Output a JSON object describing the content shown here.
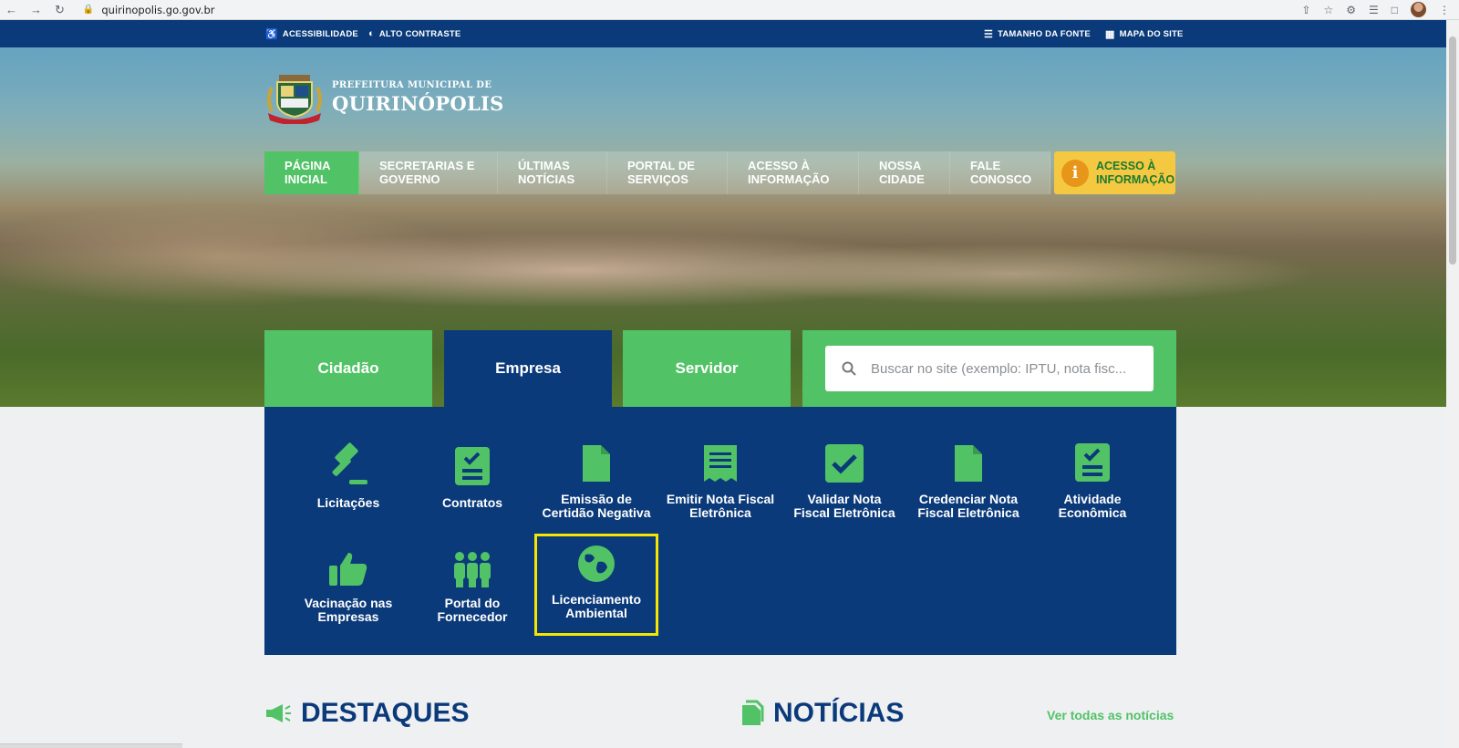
{
  "browser": {
    "url": "quirinopolis.go.gov.br"
  },
  "topbar": {
    "accessibility": "ACESSIBILIDADE",
    "contrast": "ALTO CONTRASTE",
    "font_size": "TAMANHO DA FONTE",
    "sitemap": "MAPA DO SITE"
  },
  "brand": {
    "line1": "PREFEITURA MUNICIPAL DE",
    "line2": "QUIRINÓPOLIS",
    "crest_text": "QUIRINÓPOLIS"
  },
  "menu": {
    "items": [
      {
        "line1": "Página",
        "line2": "Inicial"
      },
      {
        "line1": "Secretarias e",
        "line2": "Governo"
      },
      {
        "line1": "Últimas",
        "line2": "Notícias"
      },
      {
        "line1": "Portal de",
        "line2": "Serviços"
      },
      {
        "line1": "Acesso à",
        "line2": "Informação"
      },
      {
        "line1": "Nossa",
        "line2": "Cidade"
      },
      {
        "line1": "Fale",
        "line2": "Conosco"
      }
    ],
    "access_button": {
      "line1": "Acesso à",
      "line2": "Informação"
    }
  },
  "tabs": [
    "Cidadão",
    "Empresa",
    "Servidor"
  ],
  "search": {
    "placeholder": "Buscar no site (exemplo: IPTU, nota fisc..."
  },
  "services": [
    {
      "icon": "gavel-icon",
      "line1": "Licitações",
      "line2": ""
    },
    {
      "icon": "clipboard-check-icon",
      "line1": "Contratos",
      "line2": ""
    },
    {
      "icon": "file-icon",
      "line1": "Emissão de",
      "line2": "Certidão Negativa"
    },
    {
      "icon": "receipt-icon",
      "line1": "Emitir Nota Fiscal",
      "line2": "Eletrônica"
    },
    {
      "icon": "check-square-icon",
      "line1": "Validar Nota",
      "line2": "Fiscal Eletrônica"
    },
    {
      "icon": "file-icon",
      "line1": "Credenciar Nota",
      "line2": "Fiscal Eletrônica"
    },
    {
      "icon": "clipboard-check-icon",
      "line1": "Atividade",
      "line2": "Econômica"
    },
    {
      "icon": "thumbs-up-icon",
      "line1": "Vacinação nas",
      "line2": "Empresas"
    },
    {
      "icon": "people-group-icon",
      "line1": "Portal do",
      "line2": "Fornecedor"
    },
    {
      "icon": "globe-icon",
      "line1": "Licenciamento",
      "line2": "Ambiental"
    }
  ],
  "sections": {
    "highlights": "DESTAQUES",
    "news": "NOTÍCIAS",
    "see_all": "Ver todas as notícias"
  },
  "colors": {
    "navy": "#0b3a7a",
    "green": "#52c266",
    "yellow": "#f5c842",
    "highlight_border": "#f5e600"
  }
}
